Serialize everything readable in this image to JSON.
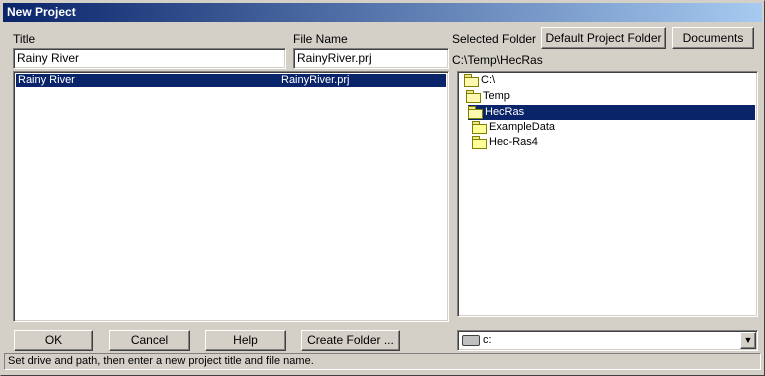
{
  "window": {
    "title": "New Project"
  },
  "labels": {
    "title": "Title",
    "file_name": "File Name",
    "selected_folder": "Selected Folder"
  },
  "inputs": {
    "title_value": "Rainy River",
    "file_name_value": "RainyRiver.prj"
  },
  "selected_folder_path": "C:\\Temp\\HecRas",
  "buttons": {
    "default_project_folder": "Default Project Folder",
    "documents": "Documents",
    "ok": "OK",
    "cancel": "Cancel",
    "help": "Help",
    "create_folder": "Create Folder ..."
  },
  "project_list": [
    {
      "title": "Rainy River",
      "file": "RainyRiver.prj",
      "selected": true
    }
  ],
  "folder_tree": [
    {
      "label": "C:\\",
      "level": 0,
      "open": true,
      "selected": false
    },
    {
      "label": "Temp",
      "level": 1,
      "open": true,
      "selected": false
    },
    {
      "label": "HecRas",
      "level": 2,
      "open": true,
      "selected": true
    },
    {
      "label": "ExampleData",
      "level": 3,
      "open": false,
      "selected": false
    },
    {
      "label": "Hec-Ras4",
      "level": 3,
      "open": false,
      "selected": false
    }
  ],
  "drive_select": {
    "value": "c:"
  },
  "status_bar": "Set drive and path, then enter a new project title and file name.",
  "colors": {
    "title_bar": "#0a246a",
    "selection": "#0a246a",
    "face": "#d4d0c8"
  }
}
